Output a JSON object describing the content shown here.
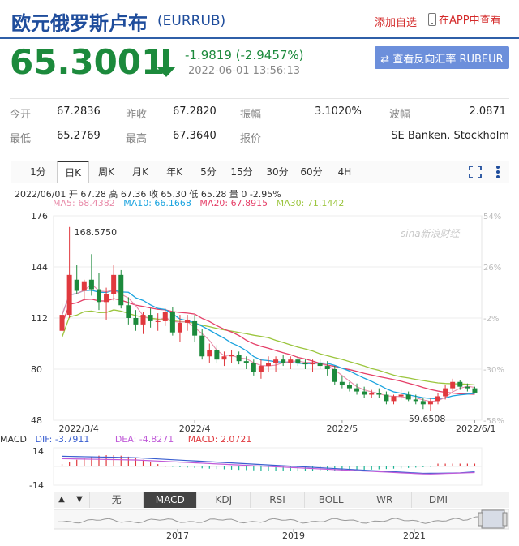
{
  "header": {
    "title": "欧元俄罗斯卢布",
    "code": "(EURRUB)",
    "add_favorite": "添加自选",
    "app_view": "在APP中查看"
  },
  "quote": {
    "price": "65.3001",
    "change": "-1.9819 (-2.9457%)",
    "time": "2022-06-01 13:56:13",
    "reverse_button": "⇄ 查看反向汇率 RUBEUR"
  },
  "stats": {
    "row1": [
      {
        "label": "今开",
        "value": "67.2836"
      },
      {
        "label": "昨收",
        "value": "67.2820"
      },
      {
        "label": "振幅",
        "value": "3.1020%"
      },
      {
        "label": "波幅",
        "value": "2.0871"
      }
    ],
    "row2": [
      {
        "label": "最低",
        "value": "65.2769"
      },
      {
        "label": "最高",
        "value": "67.3640"
      },
      {
        "label": "报价",
        "value": "SE Banken. Stockholm"
      }
    ]
  },
  "tabs": [
    "1分",
    "日K",
    "周K",
    "月K",
    "年K",
    "5分",
    "15分",
    "30分",
    "60分",
    "4H"
  ],
  "active_tab": "日K",
  "chart_info": {
    "ohlc_line": "2022/06/01 开 67.28 高 67.36 收 65.30 低 65.28 量 0 -2.95%",
    "ma5": "MA5: 68.4382",
    "ma10": "MA10: 66.1668",
    "ma20": "MA20: 67.8915",
    "ma30": "MA30: 71.1442",
    "watermark": "sina新浪财经",
    "max_label": "168.5750",
    "min_label": "59.6508"
  },
  "colors": {
    "up": "#e0393e",
    "down": "#1c8a3c",
    "ma5": "#e88aa8",
    "ma10": "#1aa3df",
    "ma20": "#e53f68",
    "ma30": "#9bc53d",
    "dif": "#3a5fd0",
    "dea": "#c05ad8",
    "brand": "#1f4d9c"
  },
  "chart_data": {
    "type": "candlestick",
    "y_ticks": [
      "176",
      "144",
      "112",
      "80",
      "48"
    ],
    "ylim": [
      48,
      176
    ],
    "pct_ticks": [
      "54%",
      "26%",
      "-2%",
      "-30%",
      "-58%"
    ],
    "x_labels": [
      "2022/3/4",
      "2022/4",
      "2022/5",
      "2022/6/1"
    ],
    "candles": [
      [
        104,
        121,
        102,
        114
      ],
      [
        114,
        169,
        112,
        139
      ],
      [
        136,
        145,
        127,
        129
      ],
      [
        129,
        136,
        123,
        135
      ],
      [
        136,
        152,
        126,
        130
      ],
      [
        130,
        140,
        117,
        122
      ],
      [
        122,
        131,
        111,
        127
      ],
      [
        127,
        145,
        123,
        139
      ],
      [
        139,
        142,
        118,
        120
      ],
      [
        120,
        125,
        108,
        112
      ],
      [
        112,
        117,
        104,
        108
      ],
      [
        108,
        116,
        102,
        114
      ],
      [
        114,
        118,
        106,
        110
      ],
      [
        110,
        115,
        104,
        110
      ],
      [
        110,
        118,
        107,
        116
      ],
      [
        116,
        119,
        101,
        103
      ],
      [
        103,
        114,
        97,
        109
      ],
      [
        109,
        114,
        104,
        111
      ],
      [
        110,
        114,
        97,
        101
      ],
      [
        101,
        105,
        86,
        88
      ],
      [
        88,
        96,
        84,
        92
      ],
      [
        92,
        95,
        84,
        86
      ],
      [
        86,
        91,
        82,
        88
      ],
      [
        88,
        92,
        84,
        89
      ],
      [
        89,
        91,
        83,
        85
      ],
      [
        85,
        88,
        80,
        84
      ],
      [
        84,
        86,
        76,
        78
      ],
      [
        78,
        86,
        74,
        82
      ],
      [
        82,
        88,
        78,
        84
      ],
      [
        84,
        88,
        78,
        86
      ],
      [
        86,
        89,
        82,
        84
      ],
      [
        84,
        88,
        80,
        86
      ],
      [
        86,
        88,
        82,
        84
      ],
      [
        84,
        86,
        80,
        83
      ],
      [
        83,
        86,
        78,
        84
      ],
      [
        84,
        86,
        80,
        82
      ],
      [
        82,
        85,
        76,
        80
      ],
      [
        80,
        82,
        70,
        72
      ],
      [
        72,
        76,
        68,
        70
      ],
      [
        70,
        72,
        66,
        68
      ],
      [
        68,
        71,
        64,
        66
      ],
      [
        66,
        69,
        62,
        64
      ],
      [
        64,
        67,
        62,
        65
      ],
      [
        65,
        68,
        62,
        64
      ],
      [
        64,
        66,
        58,
        60
      ],
      [
        60,
        64,
        58,
        63
      ],
      [
        63,
        67,
        61,
        64
      ],
      [
        64,
        66,
        60,
        61
      ],
      [
        61,
        64,
        58,
        60
      ],
      [
        60,
        62,
        55,
        58
      ],
      [
        58,
        62,
        54,
        60
      ],
      [
        60,
        65,
        58,
        63
      ],
      [
        63,
        70,
        61,
        68
      ],
      [
        68,
        74,
        66,
        72
      ],
      [
        72,
        73,
        67,
        69
      ],
      [
        69,
        71,
        66,
        68
      ],
      [
        68,
        69,
        65,
        65.3
      ]
    ],
    "macd": {
      "dif": "-3.7911",
      "dea": "-4.8271",
      "macd": "2.0721",
      "y_ticks": [
        "14",
        "-14"
      ]
    },
    "indicator_tabs": [
      "无",
      "MACD",
      "KDJ",
      "RSI",
      "BOLL",
      "WR",
      "DMI"
    ],
    "active_indicator": "MACD",
    "overview_labels": [
      "2017",
      "2019",
      "2021"
    ]
  }
}
